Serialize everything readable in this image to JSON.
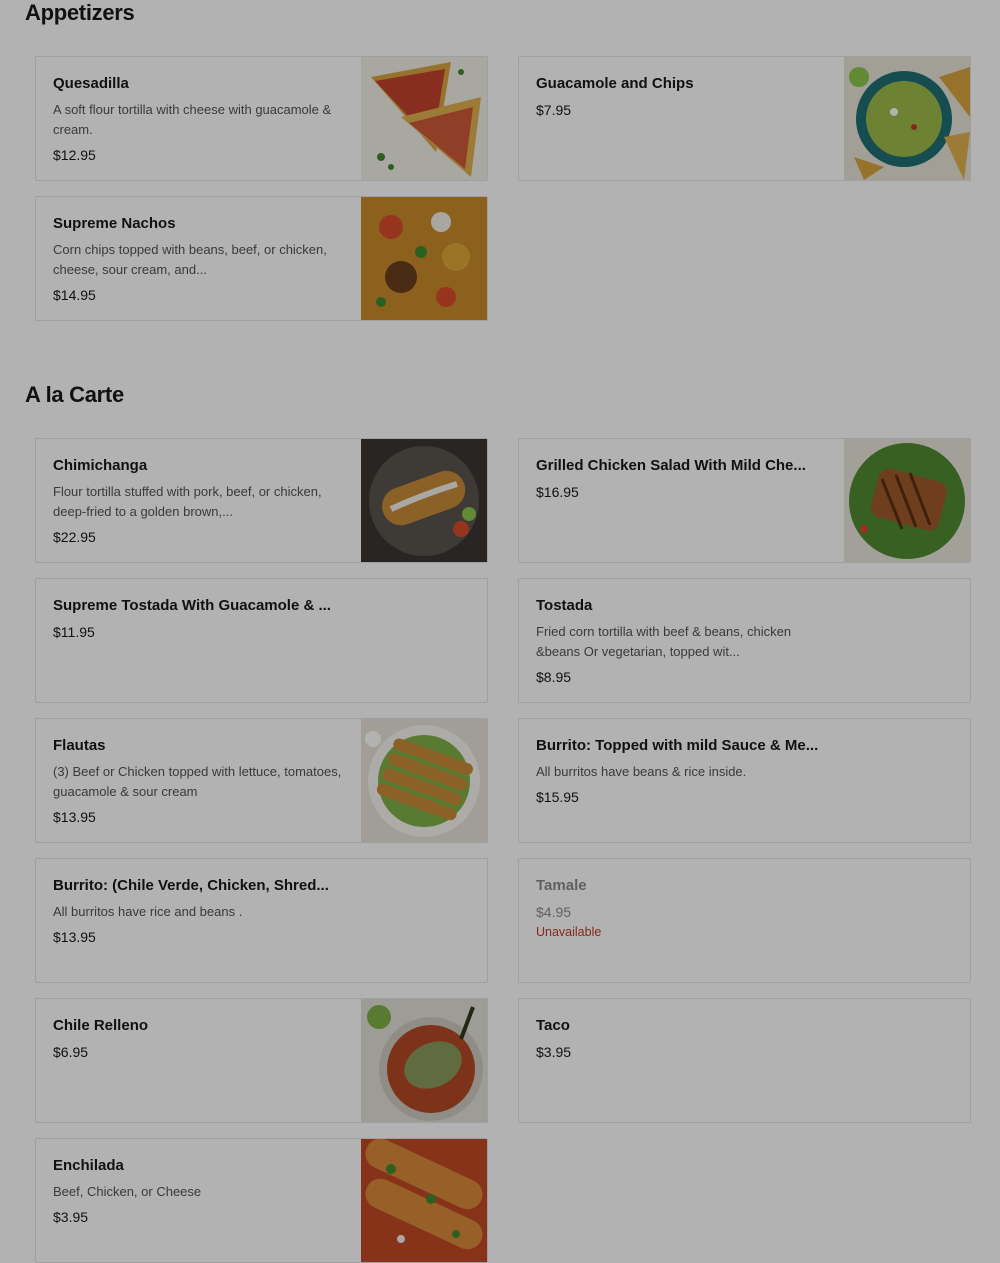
{
  "sections": {
    "appetizers": {
      "title": "Appetizers",
      "items": [
        {
          "name": "Quesadilla",
          "description": "A soft flour tortilla with cheese with guacamole & cream.",
          "price": "$12.95"
        },
        {
          "name": "Guacamole and Chips",
          "price": "$7.95"
        },
        {
          "name": "Supreme Nachos",
          "description": "Corn chips topped with beans, beef, or chicken, cheese, sour cream, and...",
          "price": "$14.95"
        }
      ]
    },
    "a_la_carte": {
      "title": "A la Carte",
      "items": [
        {
          "name": "Chimichanga",
          "description": "Flour tortilla stuffed with pork, beef, or chicken, deep-fried to a golden brown,...",
          "price": "$22.95"
        },
        {
          "name": "Grilled Chicken Salad With Mild Che...",
          "price": "$16.95"
        },
        {
          "name": "Supreme Tostada With Guacamole & ...",
          "price": "$11.95"
        },
        {
          "name": "Tostada",
          "description": "Fried corn tortilla with beef & beans, chicken &beans Or vegetarian, topped wit...",
          "price": "$8.95"
        },
        {
          "name": "Flautas",
          "description": "(3) Beef or Chicken topped with lettuce, tomatoes, guacamole & sour cream",
          "price": "$13.95"
        },
        {
          "name": "Burrito: Topped with mild Sauce & Me...",
          "description": "All burritos have beans & rice inside.",
          "price": "$15.95"
        },
        {
          "name": "Burrito: (Chile Verde, Chicken, Shred...",
          "description": "All burritos have rice and beans .",
          "price": "$13.95"
        },
        {
          "name": "Tamale",
          "price": "$4.95",
          "status": "Unavailable"
        },
        {
          "name": "Chile Relleno",
          "price": "$6.95"
        },
        {
          "name": "Taco",
          "price": "$3.95"
        },
        {
          "name": "Enchilada",
          "description": "Beef, Chicken, or Cheese",
          "price": "$3.95"
        }
      ]
    }
  },
  "colors": {
    "overlay": "rgba(0,0,0,0.3)",
    "unavailable": "#c0392b",
    "border": "#e4e4e4"
  }
}
